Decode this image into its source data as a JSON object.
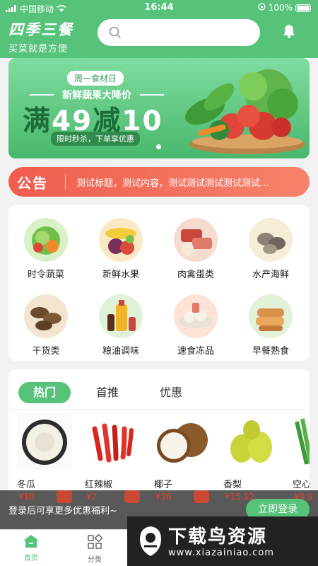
{
  "status_bar": {
    "carrier": "中国移动",
    "time": "16:44",
    "battery": "100%"
  },
  "header": {
    "logo_title": "四季三餐",
    "logo_subtitle": "买菜就是方便"
  },
  "banner": {
    "tag": "周一食材日",
    "title": "新鲜蔬果大降价",
    "promo_prefix": "满",
    "promo_threshold": "49",
    "promo_mid": "减",
    "promo_discount": "10",
    "subtitle": "限时秒杀，下单享优惠"
  },
  "notice": {
    "label": "公告",
    "text": "测试标题，测试内容，测试测试测试测试测试..."
  },
  "categories": [
    {
      "label": "时令蔬菜"
    },
    {
      "label": "新鲜水果"
    },
    {
      "label": "肉禽蛋类"
    },
    {
      "label": "水产海鲜"
    },
    {
      "label": "干货类"
    },
    {
      "label": "粮油调味"
    },
    {
      "label": "速食冻品"
    },
    {
      "label": "早餐熟食"
    }
  ],
  "product_tabs": [
    {
      "label": "热门"
    },
    {
      "label": "首推"
    },
    {
      "label": "优惠"
    }
  ],
  "products": [
    {
      "name": "冬瓜",
      "price": "¥10"
    },
    {
      "name": "红辣椒",
      "price": "¥2"
    },
    {
      "name": "椰子",
      "price": "¥36"
    },
    {
      "name": "香梨",
      "price": "¥15.12"
    },
    {
      "name": "空心",
      "price": "¥9.9"
    }
  ],
  "login_bar": {
    "text": "登录后可享更多优惠福利~",
    "button": "立即登录"
  },
  "tabbar": [
    {
      "label": "首页"
    },
    {
      "label": "分类"
    }
  ],
  "watermark": {
    "main": "下载鸟资源",
    "url": "www.xiazainiao.com"
  },
  "colors": {
    "primary_green": "#56c27a",
    "notice_red": "#ef5d4e",
    "price_red": "#e6452c"
  }
}
